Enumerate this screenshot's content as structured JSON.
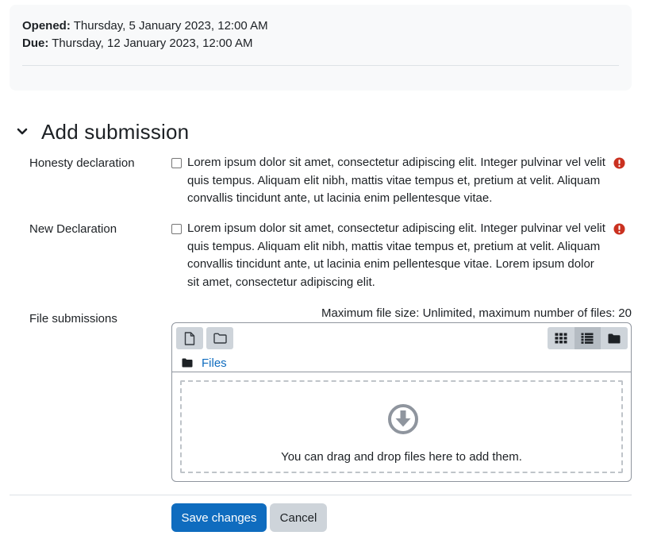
{
  "dates": {
    "opened_label": "Opened:",
    "opened_value": " Thursday, 5 January 2023, 12:00 AM",
    "due_label": "Due:",
    "due_value": " Thursday, 12 January 2023, 12:00 AM"
  },
  "section": {
    "title": "Add submission",
    "chevron_icon": "chevron-down-icon"
  },
  "fields": {
    "honesty": {
      "label": "Honesty declaration",
      "text": "Lorem ipsum dolor sit amet, consectetur adipiscing elit. Integer pulvinar vel velit quis tempus. Aliquam elit nibh, mattis vitae tempus et, pretium at velit. Aliquam convallis tincidunt ante, ut lacinia enim pellentesque vitae.",
      "checked": false,
      "required_icon": "exclamation-circle-icon"
    },
    "new_declaration": {
      "label": "New Declaration",
      "text": "Lorem ipsum dolor sit amet, consectetur adipiscing elit. Integer pulvinar vel velit quis tempus. Aliquam elit nibh, mattis vitae tempus et, pretium at velit. Aliquam convallis tincidunt ante, ut lacinia enim pellentesque vitae. Lorem ipsum dolor sit amet, consectetur adipiscing elit.",
      "checked": false,
      "required_icon": "exclamation-circle-icon"
    },
    "files": {
      "label": "File submissions",
      "max_size": "Maximum file size: Unlimited, maximum number of files: 20",
      "path_label": "Files",
      "drop_text": "You can drag and drop files here to add them.",
      "toolbar_icons": [
        "add-file-icon",
        "create-folder-icon"
      ],
      "view_icons": [
        "grid-view-icon",
        "list-view-icon",
        "tree-view-icon"
      ],
      "active_view": "list-view-icon"
    }
  },
  "buttons": {
    "save": "Save changes",
    "cancel": "Cancel"
  },
  "colors": {
    "primary": "#0f6cbf",
    "danger": "#ca3120",
    "secondary_btn": "#ced4da",
    "card_bg": "#f8f9fa"
  }
}
